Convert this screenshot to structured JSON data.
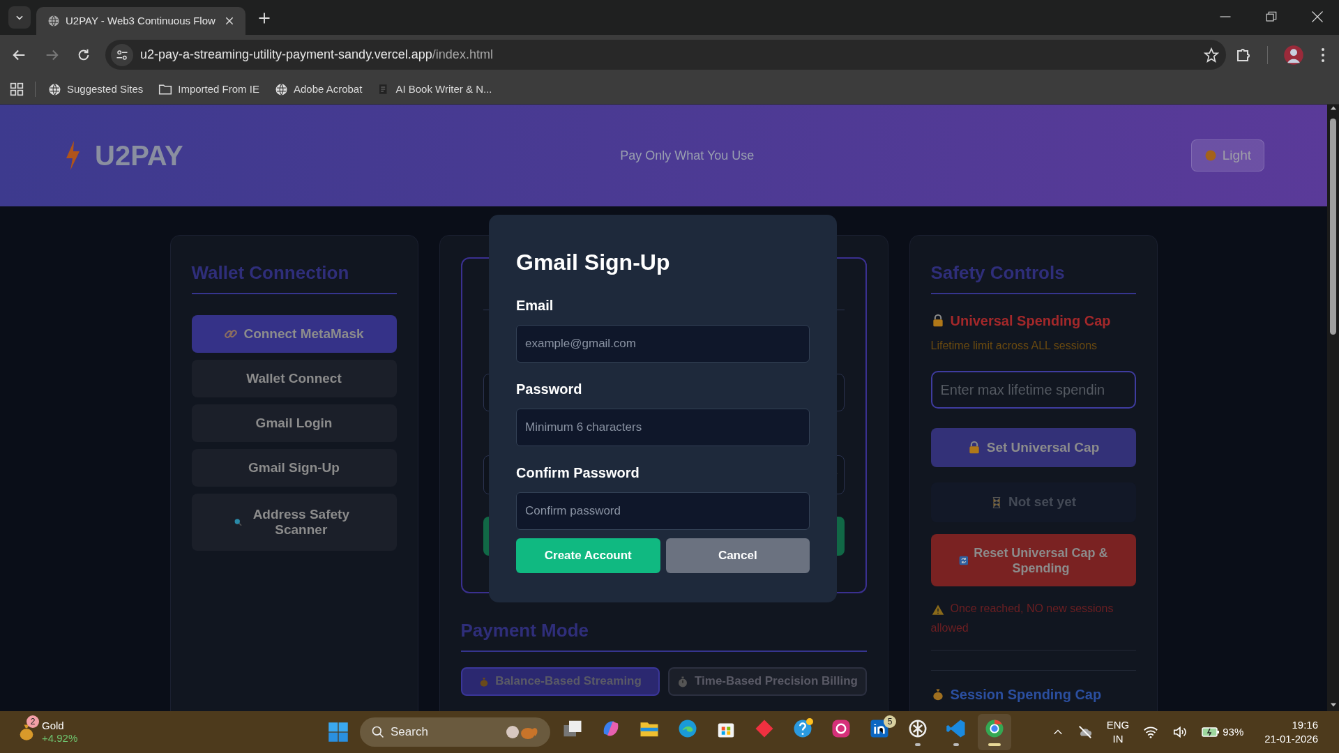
{
  "browser": {
    "tab_title": "U2PAY - Web3 Continuous Flow",
    "url_host": "u2-pay-a-streaming-utility-payment-sandy.vercel.app",
    "url_path": "/index.html",
    "bookmarks": [
      {
        "label": "Suggested Sites",
        "kind": "globe"
      },
      {
        "label": "Imported From IE",
        "kind": "folder"
      },
      {
        "label": "Adobe Acrobat",
        "kind": "globe"
      },
      {
        "label": "AI Book Writer & N...",
        "kind": "page"
      }
    ]
  },
  "header": {
    "logo": "U2PAY",
    "tagline": "Pay Only What You Use",
    "theme_button": "Light"
  },
  "wallet_panel": {
    "title": "Wallet Connection",
    "buttons": [
      {
        "label": "Connect MetaMask",
        "kind": "primary"
      },
      {
        "label": "Wallet Connect",
        "kind": "secondary"
      },
      {
        "label": "Gmail Login",
        "kind": "secondary"
      },
      {
        "label": "Gmail Sign-Up",
        "kind": "secondary"
      },
      {
        "label": "Address Safety Scanner",
        "kind": "secondary"
      }
    ]
  },
  "session_panel": {
    "payment_mode": {
      "title": "Payment Mode",
      "options": [
        {
          "label": "Balance-Based Streaming",
          "selected": true
        },
        {
          "label": "Time-Based Precision Billing",
          "selected": false
        }
      ]
    }
  },
  "signup_modal": {
    "title": "Gmail Sign-Up",
    "fields": [
      {
        "label": "Email",
        "placeholder": "example@gmail.com"
      },
      {
        "label": "Password",
        "placeholder": "Minimum 6 characters"
      },
      {
        "label": "Confirm Password",
        "placeholder": "Confirm password"
      }
    ],
    "buttons": [
      {
        "label": "Create Account",
        "kind": "primary"
      },
      {
        "label": "Cancel",
        "kind": "secondary"
      }
    ]
  },
  "safety_panel": {
    "title": "Safety Controls",
    "universal_cap": {
      "heading": "Universal Spending Cap",
      "description": "Lifetime limit across ALL sessions",
      "input_placeholder": "Enter max lifetime spendin",
      "set_button": "Set Universal Cap",
      "status": "Not set yet",
      "reset_button": "Reset Universal Cap & Spending",
      "warning": "Once reached, NO new sessions allowed"
    },
    "session_cap_heading": "Session Spending Cap"
  },
  "taskbar": {
    "widget": {
      "title": "Gold",
      "change": "+4.92%",
      "badge": "2"
    },
    "search_placeholder": "Search",
    "apps": [
      {
        "kind": "taskview",
        "running": false,
        "selected": false
      },
      {
        "kind": "copilot",
        "running": false,
        "selected": false
      },
      {
        "kind": "explorer",
        "running": false,
        "selected": false
      },
      {
        "kind": "edge",
        "running": false,
        "selected": false
      },
      {
        "kind": "store",
        "running": false,
        "selected": false
      },
      {
        "kind": "diamond",
        "running": false,
        "selected": false
      },
      {
        "kind": "help",
        "running": false,
        "selected": false
      },
      {
        "kind": "instagram",
        "running": false,
        "selected": false
      },
      {
        "kind": "linkedin",
        "running": false,
        "selected": false,
        "badge": "5"
      },
      {
        "kind": "chatgpt",
        "running": true,
        "selected": false
      },
      {
        "kind": "vscode",
        "running": true,
        "selected": false
      },
      {
        "kind": "chrome",
        "running": true,
        "selected": true
      }
    ],
    "language": "ENG",
    "region": "IN",
    "battery": "93%",
    "time": "19:16",
    "date": "21-01-2026"
  }
}
